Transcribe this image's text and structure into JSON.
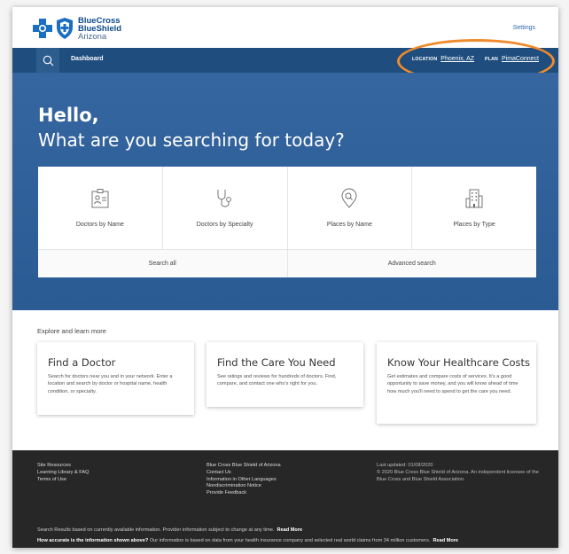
{
  "brand": {
    "line1": "BlueCross",
    "line2": "BlueShield",
    "line3": "Arizona"
  },
  "header": {
    "settings": "Settings"
  },
  "nav": {
    "dashboard": "Dashboard",
    "location_label": "LOCATION",
    "location_value": "Phoenix, AZ",
    "plan_label": "PLAN",
    "plan_value": "PimaConnect"
  },
  "hero": {
    "hello": "Hello,",
    "subtitle": "What are you searching for today?",
    "tiles": [
      {
        "label": "Doctors by Name",
        "icon": "id-card-icon"
      },
      {
        "label": "Doctors by Specialty",
        "icon": "stethoscope-icon"
      },
      {
        "label": "Places by Name",
        "icon": "map-pin-search-icon"
      },
      {
        "label": "Places by Type",
        "icon": "building-icon"
      }
    ],
    "search_all": "Search all",
    "advanced_search": "Advanced search"
  },
  "explore": {
    "title": "Explore and learn more",
    "cards": [
      {
        "title": "Find a Doctor",
        "text": "Search for doctors near you and in your network. Enter a location and search by doctor or hospital name, health condition, or specialty."
      },
      {
        "title": "Find the Care You Need",
        "text": "See ratings and reviews for hundreds of doctors. Find, compare, and contact one who's right for you."
      },
      {
        "title": "Know Your Healthcare Costs",
        "text": "Get estimates and compare costs of services. It's a good opportunity to save money, and you will know ahead of time how much you'll need to spend to get the care you need."
      }
    ]
  },
  "footer": {
    "col1": [
      "Site Resources",
      "Learning Library & FAQ",
      "Terms of Use"
    ],
    "col2": [
      "Blue Cross Blue Shield of Arizona",
      "Contact Us",
      "Information in Other Languages",
      "Nondiscrimination Notice",
      "Provide Feedback"
    ],
    "last_updated": "Last updated: 01/08/2020",
    "copyright": "© 2020 Blue Cross Blue Shield of Arizona. An independent licensee of the Blue Cross and Blue Shield Association.",
    "note1": "Search Results based on currently available information. Provider information subject to change at any time.",
    "note1_link": "Read More",
    "note2_bold": "How accurate is the information shown above?",
    "note2": " Our information is based on data from your health insurance company and selected real world claims from 34 million customers.",
    "note2_link": "Read More"
  },
  "colors": {
    "nav": "#1f4e7e",
    "hero": "#3666a0",
    "highlight": "#f08a2a",
    "footer": "#272727"
  }
}
